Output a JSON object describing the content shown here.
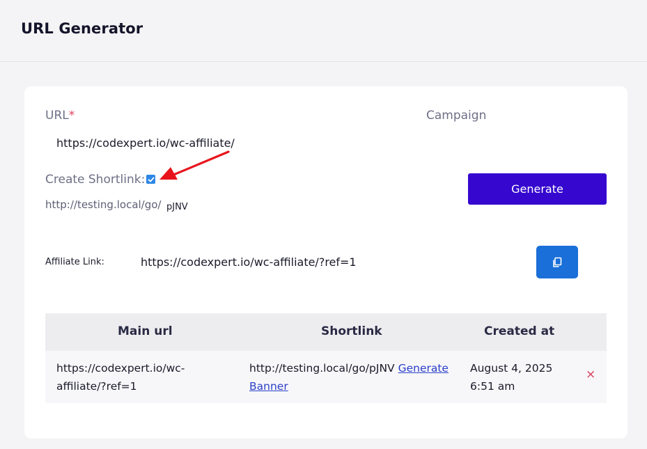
{
  "header": {
    "title": "URL Generator"
  },
  "form": {
    "url_label": "URL",
    "url_required_mark": "*",
    "url_value": "https://codexpert.io/wc-affiliate/",
    "campaign_label": "Campaign",
    "shortlink_label": "Create Shortlink:",
    "shortlink_checked": true,
    "shortlink_base": "http://testing.local/go/",
    "shortlink_slug": "pJNV",
    "generate_label": "Generate"
  },
  "affiliate": {
    "label": "Affiliate Link:",
    "value": "https://codexpert.io/wc-affiliate/?ref=1",
    "copy_icon": "copy-icon"
  },
  "table": {
    "headers": [
      "Main url",
      "Shortlink",
      "Created at"
    ],
    "rows": [
      {
        "main_url_line1": "https://codexpert.io/wc-",
        "main_url_line2": "affiliate/?ref=1",
        "shortlink": "http://testing.local/go/pJNV",
        "generate_banner_line1": "Generate",
        "generate_banner_line2": "Banner",
        "created_line1": "August 4, 2025",
        "created_line2": "6:51 am",
        "delete_icon": "×"
      }
    ]
  },
  "colors": {
    "accent": "#3607cf",
    "copy_button": "#1a6fd8",
    "annotation_arrow": "#e8141c",
    "delete": "#d63a55"
  }
}
